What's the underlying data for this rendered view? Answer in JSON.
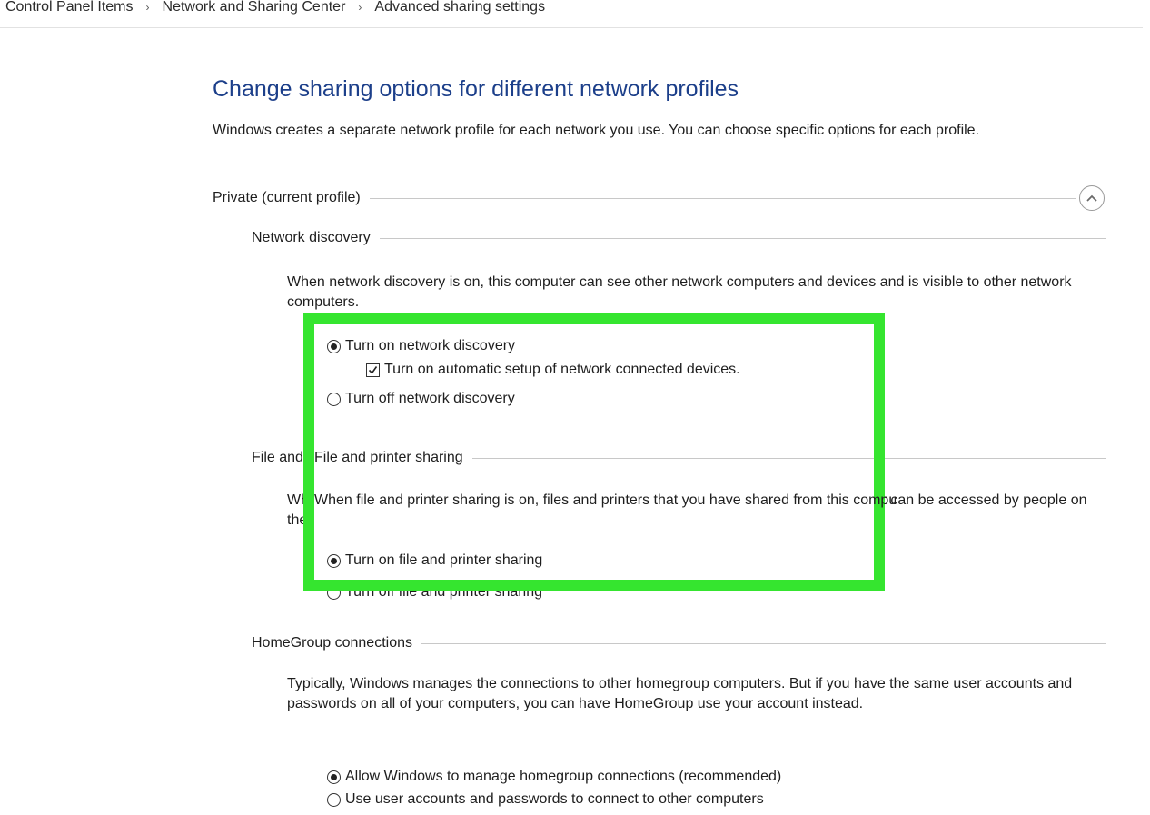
{
  "breadcrumb": {
    "items": [
      "Control Panel Items",
      "Network and Sharing Center",
      "Advanced sharing settings"
    ],
    "separator": "›"
  },
  "page": {
    "title": "Change sharing options for different network profiles",
    "intro": "Windows creates a separate network profile for each network you use. You can choose specific options for each profile."
  },
  "profile": {
    "header": "Private (current profile)",
    "collapse_icon": "chevron-up-icon"
  },
  "network_discovery": {
    "header": "Network discovery",
    "description": "When network discovery is on, this computer can see other network computers and devices and is visible to other network computers.",
    "options": {
      "on": "Turn on network discovery",
      "auto_setup": "Turn on automatic setup of network connected devices.",
      "off": "Turn off network discovery"
    },
    "selected": "on",
    "auto_setup_checked": true
  },
  "file_printer_sharing": {
    "header": "File and printer sharing",
    "description": "When file and printer sharing is on, files and printers that you have shared from this computer can be accessed by people on the network.",
    "options": {
      "on": "Turn on file and printer sharing",
      "off": "Turn off file and printer sharing"
    },
    "selected": "on"
  },
  "homegroup": {
    "header": "HomeGroup connections",
    "description": "Typically, Windows manages the connections to other homegroup computers. But if you have the same user accounts and passwords on all of your computers, you can have HomeGroup use your account instead.",
    "options": {
      "windows": "Allow Windows to manage homegroup connections (recommended)",
      "accounts": "Use user accounts and passwords to connect to other computers"
    },
    "selected": "windows"
  },
  "colors": {
    "title": "#1c3f8a",
    "highlight": "#35e52f"
  }
}
